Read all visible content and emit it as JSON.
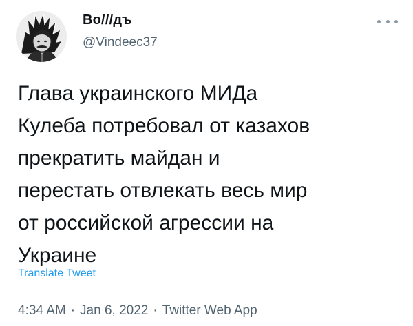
{
  "author": {
    "display_name": "Во///дъ",
    "handle": "@Vindeec37"
  },
  "tweet": {
    "text_lines": [
      "Глава украинского МИДа",
      "Кулеба потребовал от казахов",
      "прекратить майдан и",
      "перестать отвлекать весь мир",
      "от российской агрессии на",
      "Украине"
    ],
    "translate_label": "Translate Tweet"
  },
  "meta": {
    "time": "4:34 AM",
    "separator": "·",
    "date": "Jan 6, 2022",
    "source": "Twitter Web App"
  },
  "icons": {
    "more": "more-horizontal-icon",
    "avatar": "profile-avatar"
  },
  "colors": {
    "text": "#0f1419",
    "secondary": "#536471",
    "link": "#1d9bf0"
  }
}
